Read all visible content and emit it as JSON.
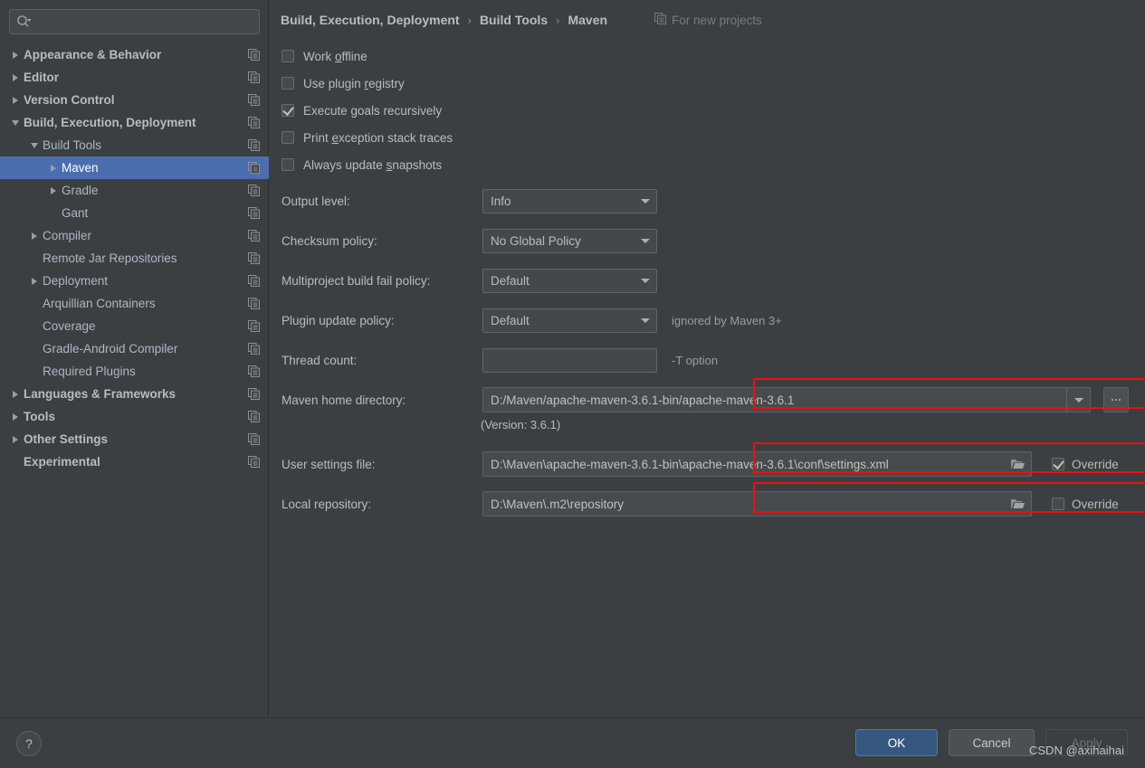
{
  "sidebar": {
    "search": {
      "placeholder": "",
      "value": "",
      "icon": "search-icon"
    },
    "items": [
      {
        "label": "Appearance & Behavior",
        "indent": 0,
        "arrow": "right",
        "bold": true,
        "selected": false
      },
      {
        "label": "Editor",
        "indent": 0,
        "arrow": "right",
        "bold": true,
        "selected": false
      },
      {
        "label": "Version Control",
        "indent": 0,
        "arrow": "right",
        "bold": true,
        "selected": false
      },
      {
        "label": "Build, Execution, Deployment",
        "indent": 0,
        "arrow": "down",
        "bold": true,
        "selected": false
      },
      {
        "label": "Build Tools",
        "indent": 1,
        "arrow": "down",
        "bold": false,
        "selected": false
      },
      {
        "label": "Maven",
        "indent": 2,
        "arrow": "right",
        "bold": false,
        "selected": true
      },
      {
        "label": "Gradle",
        "indent": 2,
        "arrow": "right",
        "bold": false,
        "selected": false
      },
      {
        "label": "Gant",
        "indent": 2,
        "arrow": "none",
        "bold": false,
        "selected": false
      },
      {
        "label": "Compiler",
        "indent": 1,
        "arrow": "right",
        "bold": false,
        "selected": false
      },
      {
        "label": "Remote Jar Repositories",
        "indent": 1,
        "arrow": "none",
        "bold": false,
        "selected": false
      },
      {
        "label": "Deployment",
        "indent": 1,
        "arrow": "right",
        "bold": false,
        "selected": false
      },
      {
        "label": "Arquillian Containers",
        "indent": 1,
        "arrow": "none",
        "bold": false,
        "selected": false
      },
      {
        "label": "Coverage",
        "indent": 1,
        "arrow": "none",
        "bold": false,
        "selected": false
      },
      {
        "label": "Gradle-Android Compiler",
        "indent": 1,
        "arrow": "none",
        "bold": false,
        "selected": false
      },
      {
        "label": "Required Plugins",
        "indent": 1,
        "arrow": "none",
        "bold": false,
        "selected": false
      },
      {
        "label": "Languages & Frameworks",
        "indent": 0,
        "arrow": "right",
        "bold": true,
        "selected": false
      },
      {
        "label": "Tools",
        "indent": 0,
        "arrow": "right",
        "bold": true,
        "selected": false
      },
      {
        "label": "Other Settings",
        "indent": 0,
        "arrow": "right",
        "bold": true,
        "selected": false
      },
      {
        "label": "Experimental",
        "indent": 0,
        "arrow": "none",
        "bold": true,
        "selected": false
      }
    ]
  },
  "header": {
    "breadcrumb": [
      "Build, Execution, Deployment",
      "Build Tools",
      "Maven"
    ],
    "separator": "›",
    "for_new_projects": "For new projects",
    "for_new_projects_icon": "copy-icon"
  },
  "main": {
    "checkboxes": [
      {
        "label_pre": "Work ",
        "mnemonic": "o",
        "label_post": "ffline",
        "checked": false
      },
      {
        "label_pre": "Use plugin ",
        "mnemonic": "r",
        "label_post": "egistry",
        "checked": false
      },
      {
        "label_pre": "Execute ",
        "mnemonic": "g",
        "label_post": "oals recursively",
        "checked": true
      },
      {
        "label_pre": "Print ",
        "mnemonic": "e",
        "label_post": "xception stack traces",
        "checked": false
      },
      {
        "label_pre": "Always update ",
        "mnemonic": "s",
        "label_post": "napshots",
        "checked": false
      }
    ],
    "fields": [
      {
        "label": "Output level:",
        "value": "Info",
        "kind": "combo",
        "hint": ""
      },
      {
        "label": "Checksum policy:",
        "value": "No Global Policy",
        "kind": "combo",
        "hint": ""
      },
      {
        "label": "Multiproject build fail policy:",
        "value": "Default",
        "kind": "combo",
        "hint": ""
      },
      {
        "label": "Plugin update policy:",
        "value": "Default",
        "kind": "combo",
        "hint": "ignored by Maven 3+"
      },
      {
        "label": "Thread count:",
        "value": "",
        "kind": "text",
        "hint": "-T option"
      }
    ],
    "maven_home": {
      "label": "Maven home directory:",
      "value": "D:/Maven/apache-maven-3.6.1-bin/apache-maven-3.6.1",
      "browse_label": "...",
      "version_text": "(Version: 3.6.1)",
      "highlighted": true
    },
    "user_settings": {
      "label": "User settings file:",
      "value": "D:\\Maven\\apache-maven-3.6.1-bin\\apache-maven-3.6.1\\conf\\settings.xml",
      "override_label": "Override",
      "override_checked": true,
      "highlighted": true
    },
    "local_repository": {
      "label": "Local repository:",
      "value": "D:\\Maven\\.m2\\repository",
      "override_label": "Override",
      "override_checked": false,
      "highlighted": true
    }
  },
  "footer": {
    "help_label": "?",
    "ok_label": "OK",
    "cancel_label": "Cancel",
    "apply_label": "Apply",
    "apply_disabled": true,
    "watermark": "CSDN @axihaihai"
  },
  "colors": {
    "background": "#3c3f41",
    "selection": "#4b6eaf",
    "accent_ok": "#365880",
    "highlight_red": "#f20d0d",
    "text": "#bbbbbb"
  }
}
